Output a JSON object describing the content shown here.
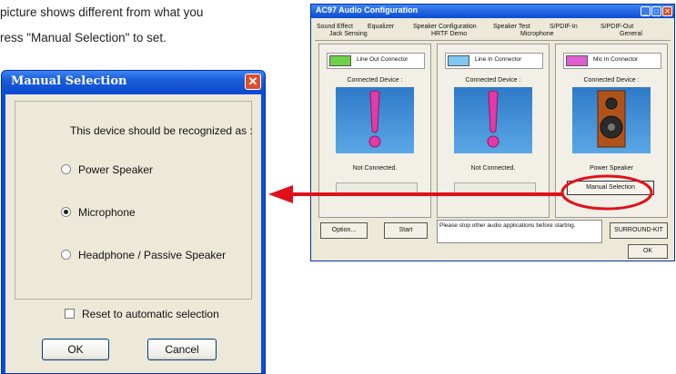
{
  "intro": {
    "line1": "picture shows different from what you",
    "line2": "ress \"Manual Selection\" to set."
  },
  "dialog": {
    "title": "Manual Selection",
    "close_glyph": "✕",
    "prompt": "This device should be recognized as :",
    "options": [
      {
        "label": "Power Speaker",
        "selected": false
      },
      {
        "label": "Microphone",
        "selected": true
      },
      {
        "label": "Headphone / Passive Speaker",
        "selected": false
      }
    ],
    "reset_label": "Reset to automatic selection",
    "reset_checked": false,
    "ok_label": "OK",
    "cancel_label": "Cancel"
  },
  "ac97": {
    "title": "AC97 Audio Configuration",
    "window_controls": [
      "_",
      "□",
      "✕"
    ],
    "tabs_row1": [
      "Sound Effect",
      "Equalizer",
      "Speaker Configuration",
      "Speaker Test",
      "S/PDIF-In",
      "S/PDIF-Out"
    ],
    "tabs_row2": [
      "Jack Sensing",
      "HRTF Demo",
      "Microphone",
      "General"
    ],
    "connected_label": "Connected Device :",
    "panels": [
      {
        "connector": "Line Out Connector",
        "jack_color": "#6fd14a",
        "status": "Not Connected.",
        "image": "exclamation-icon"
      },
      {
        "connector": "Line In Connector",
        "jack_color": "#7fc8f0",
        "status": "Not Connected.",
        "image": "exclamation-icon"
      },
      {
        "connector": "Mic In Connector",
        "jack_color": "#e05fd0",
        "status": "Power Speaker",
        "image": "speaker-icon"
      }
    ],
    "manual_selection_label": "Manual Selection",
    "option_label": "Option...",
    "start_label": "Start",
    "message": "Please stop other audio applications before starting.",
    "surround_label": "SURROUND-KIT",
    "ok_label": "OK"
  },
  "colors": {
    "arrow": "#e0101a",
    "highlight": "#e0101a",
    "xp_title": "#0c4bd0"
  }
}
